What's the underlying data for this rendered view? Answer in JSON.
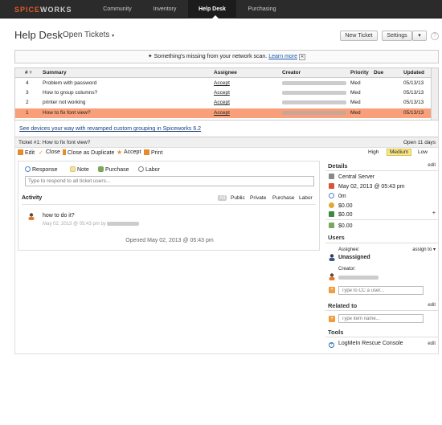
{
  "topnav": {
    "logo_prefix": "SPICE",
    "logo_suffix": "WORKS",
    "items": [
      {
        "label": "Community"
      },
      {
        "label": "Inventory"
      },
      {
        "label": "Help Desk"
      },
      {
        "label": "Purchasing"
      }
    ]
  },
  "header": {
    "title": "Help Desk",
    "subtitle": "Open Tickets",
    "new_ticket_label": "New Ticket",
    "settings_label": "Settings",
    "help_label": "?"
  },
  "notice": {
    "text": "Something's missing from your network scan.",
    "link": "Learn more"
  },
  "table": {
    "columns": {
      "num": "#",
      "summary": "Summary",
      "assignee": "Assignee",
      "creator": "Creator",
      "priority": "Priority",
      "due": "Due",
      "updated": "Updated"
    },
    "rows": [
      {
        "num": "4",
        "summary": "Problem with password",
        "assignee": "Accept",
        "priority": "Med",
        "due": "",
        "updated": "05/13/13"
      },
      {
        "num": "3",
        "summary": "How to group columns?",
        "assignee": "Accept",
        "priority": "Med",
        "due": "",
        "updated": "05/13/13"
      },
      {
        "num": "2",
        "summary": "printer not working",
        "assignee": "Accept",
        "priority": "Med",
        "due": "",
        "updated": "05/13/13"
      },
      {
        "num": "1",
        "summary": "How to fix font view?",
        "assignee": "Accept",
        "priority": "Med",
        "due": "",
        "updated": "05/13/13"
      }
    ]
  },
  "devices_link": "See devices your way with revamped custom grouping in Spiceworks 6.2",
  "ticket": {
    "title": "Ticket #1: How to fix font view?",
    "open_for": "Open 11 days",
    "actions": {
      "edit": "Edit",
      "close": "Close",
      "close_dup": "Close as Duplicate",
      "accept": "Accept",
      "print": "Print"
    },
    "priority": {
      "high": "High",
      "medium": "Medium",
      "low": "Low",
      "selected": "Medium"
    }
  },
  "response": {
    "tabs": {
      "response": "Response",
      "note": "Note",
      "purchase": "Purchase",
      "labor": "Labor"
    },
    "placeholder": "Type to respond to all ticket users...",
    "activity_title": "Activity",
    "filters": {
      "all": "All",
      "public": "Public",
      "private": "Private",
      "purchase": "Purchase",
      "labor": "Labor"
    },
    "comment_text": "how to do it?",
    "comment_meta": "May 02, 2013 @ 05:43 pm by",
    "opened": "Opened May 02, 2013 @ 05:43 pm"
  },
  "details": {
    "title": "Details",
    "edit": "edit",
    "category": "Central Server",
    "due": "May 02, 2013 @ 05:43 pm",
    "time": "0m",
    "cost1": "$0.00",
    "cost2": "$0.00",
    "cost3": "$0.00"
  },
  "users": {
    "title": "Users",
    "assignee_label": "Assignee:",
    "assign_to": "assign to",
    "assignee_value": "Unassigned",
    "creator_label": "Creator:",
    "cc_placeholder": "Type to CC a user..."
  },
  "related": {
    "title": "Related to",
    "edit": "edit",
    "placeholder": "Type item name..."
  },
  "tools": {
    "title": "Tools",
    "item": "LogMeIn Rescue Console",
    "edit": "edit"
  },
  "colors": {
    "topbar": "#2b2b2b",
    "selected_row": "#f9a07a",
    "accent": "#e25b26",
    "link": "#1a5ba8"
  }
}
